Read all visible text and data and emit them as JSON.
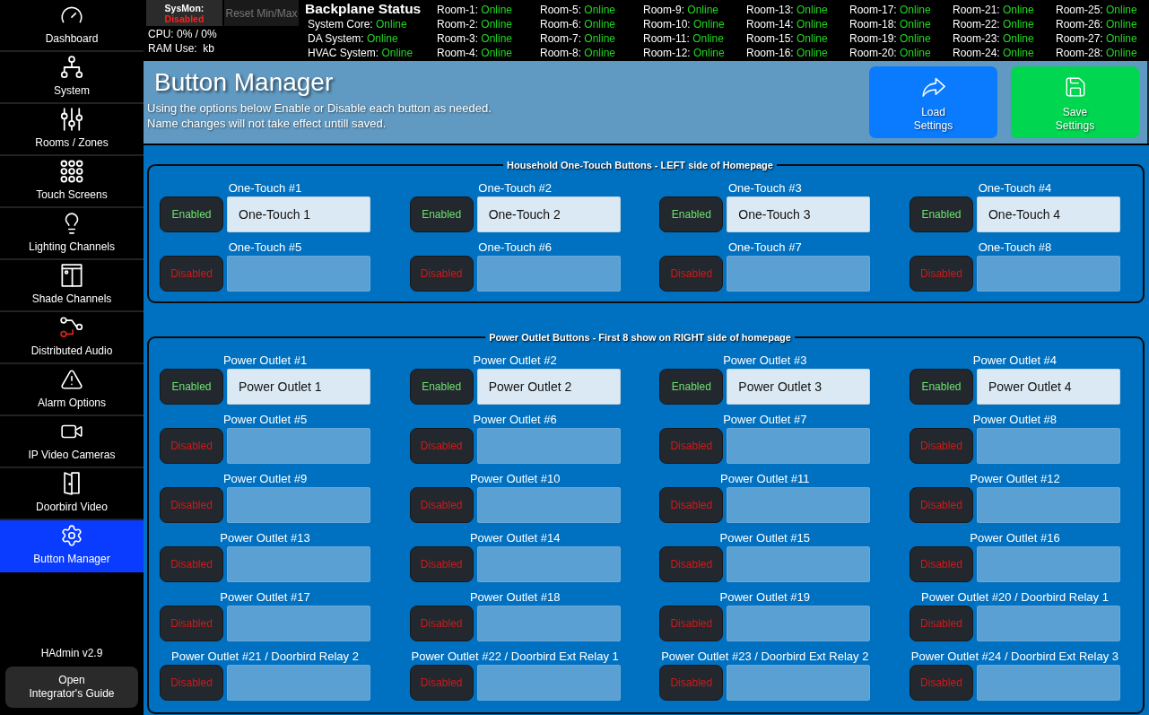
{
  "sidebar": {
    "items": [
      {
        "label": "Dashboard",
        "selected": false
      },
      {
        "label": "System",
        "selected": false
      },
      {
        "label": "Rooms / Zones",
        "selected": false
      },
      {
        "label": "Touch Screens",
        "selected": false
      },
      {
        "label": "Lighting Channels",
        "selected": false
      },
      {
        "label": "Shade Channels",
        "selected": false
      },
      {
        "label": "Distributed Audio",
        "selected": false
      },
      {
        "label": "Alarm Options",
        "selected": false
      },
      {
        "label": "IP Video Cameras",
        "selected": false
      },
      {
        "label": "Doorbird Video",
        "selected": false
      },
      {
        "label": "Button Manager",
        "selected": true
      }
    ],
    "version": "HAdmin v2.9",
    "guide_button": [
      "Open",
      "Integrator's Guide"
    ]
  },
  "status_bar": {
    "sysmon_button": {
      "label": "SysMon:",
      "status": "Disabled"
    },
    "reset_button": "Reset Min/Max",
    "cpu": "CPU: 0% / 0%",
    "ram": "RAM Use:  kb",
    "backplane": {
      "title": "Backplane Status",
      "systems": [
        {
          "name": "System Core:",
          "status": "Online"
        },
        {
          "name": "DA System:",
          "status": "Online"
        },
        {
          "name": "HVAC System:",
          "status": "Online"
        }
      ],
      "rooms": [
        {
          "name": "Room-1:",
          "status": "Online"
        },
        {
          "name": "Room-2:",
          "status": "Online"
        },
        {
          "name": "Room-3:",
          "status": "Online"
        },
        {
          "name": "Room-4:",
          "status": "Online"
        },
        {
          "name": "Room-5:",
          "status": "Online"
        },
        {
          "name": "Room-6:",
          "status": "Online"
        },
        {
          "name": "Room-7:",
          "status": "Online"
        },
        {
          "name": "Room-8:",
          "status": "Online"
        },
        {
          "name": "Room-9:",
          "status": "Online"
        },
        {
          "name": "Room-10:",
          "status": "Online"
        },
        {
          "name": "Room-11:",
          "status": "Online"
        },
        {
          "name": "Room-12:",
          "status": "Online"
        },
        {
          "name": "Room-13:",
          "status": "Online"
        },
        {
          "name": "Room-14:",
          "status": "Online"
        },
        {
          "name": "Room-15:",
          "status": "Online"
        },
        {
          "name": "Room-16:",
          "status": "Online"
        },
        {
          "name": "Room-17:",
          "status": "Online"
        },
        {
          "name": "Room-18:",
          "status": "Online"
        },
        {
          "name": "Room-19:",
          "status": "Online"
        },
        {
          "name": "Room-20:",
          "status": "Online"
        },
        {
          "name": "Room-21:",
          "status": "Online"
        },
        {
          "name": "Room-22:",
          "status": "Online"
        },
        {
          "name": "Room-23:",
          "status": "Online"
        },
        {
          "name": "Room-24:",
          "status": "Online"
        },
        {
          "name": "Room-25:",
          "status": "Online"
        },
        {
          "name": "Room-26:",
          "status": "Online"
        },
        {
          "name": "Room-27:",
          "status": "Online"
        },
        {
          "name": "Room-28:",
          "status": "Online"
        }
      ]
    }
  },
  "header": {
    "title": "Button Manager",
    "description": [
      "Using the options below Enable or Disable each button as needed.",
      "Name changes will not take effect untill saved."
    ],
    "buttons": [
      {
        "kind": "load",
        "label": [
          "Load",
          "Settings"
        ]
      },
      {
        "kind": "save",
        "label": [
          "Save",
          "Settings"
        ]
      }
    ]
  },
  "groups": [
    {
      "title": "Household One-Touch Buttons - LEFT side of Homepage",
      "buttons": [
        {
          "label": "One-Touch #1",
          "enabled": true,
          "toggle": "Enabled",
          "value": "One-Touch 1"
        },
        {
          "label": "One-Touch #2",
          "enabled": true,
          "toggle": "Enabled",
          "value": "One-Touch 2"
        },
        {
          "label": "One-Touch #3",
          "enabled": true,
          "toggle": "Enabled",
          "value": "One-Touch 3"
        },
        {
          "label": "One-Touch #4",
          "enabled": true,
          "toggle": "Enabled",
          "value": "One-Touch 4"
        },
        {
          "label": "One-Touch #5",
          "enabled": false,
          "toggle": "Disabled"
        },
        {
          "label": "One-Touch #6",
          "enabled": false,
          "toggle": "Disabled"
        },
        {
          "label": "One-Touch #7",
          "enabled": false,
          "toggle": "Disabled"
        },
        {
          "label": "One-Touch #8",
          "enabled": false,
          "toggle": "Disabled"
        }
      ]
    },
    {
      "title": "Power Outlet Buttons - First 8 show on RIGHT side of homepage",
      "buttons": [
        {
          "label": "Power Outlet #1",
          "enabled": true,
          "toggle": "Enabled",
          "value": "Power Outlet 1"
        },
        {
          "label": "Power Outlet #2",
          "enabled": true,
          "toggle": "Enabled",
          "value": "Power Outlet 2"
        },
        {
          "label": "Power Outlet #3",
          "enabled": true,
          "toggle": "Enabled",
          "value": "Power Outlet 3"
        },
        {
          "label": "Power Outlet #4",
          "enabled": true,
          "toggle": "Enabled",
          "value": "Power Outlet 4"
        },
        {
          "label": "Power Outlet #5",
          "enabled": false,
          "toggle": "Disabled"
        },
        {
          "label": "Power Outlet #6",
          "enabled": false,
          "toggle": "Disabled"
        },
        {
          "label": "Power Outlet #7",
          "enabled": false,
          "toggle": "Disabled"
        },
        {
          "label": "Power Outlet #8",
          "enabled": false,
          "toggle": "Disabled"
        },
        {
          "label": "Power Outlet #9",
          "enabled": false,
          "toggle": "Disabled"
        },
        {
          "label": "Power Outlet #10",
          "enabled": false,
          "toggle": "Disabled"
        },
        {
          "label": "Power Outlet #11",
          "enabled": false,
          "toggle": "Disabled"
        },
        {
          "label": "Power Outlet #12",
          "enabled": false,
          "toggle": "Disabled"
        },
        {
          "label": "Power Outlet #13",
          "enabled": false,
          "toggle": "Disabled"
        },
        {
          "label": "Power Outlet #14",
          "enabled": false,
          "toggle": "Disabled"
        },
        {
          "label": "Power Outlet #15",
          "enabled": false,
          "toggle": "Disabled"
        },
        {
          "label": "Power Outlet #16",
          "enabled": false,
          "toggle": "Disabled"
        },
        {
          "label": "Power Outlet #17",
          "enabled": false,
          "toggle": "Disabled"
        },
        {
          "label": "Power Outlet #18",
          "enabled": false,
          "toggle": "Disabled"
        },
        {
          "label": "Power Outlet #19",
          "enabled": false,
          "toggle": "Disabled"
        },
        {
          "label": "Power Outlet #20 / Doorbird Relay 1",
          "enabled": false,
          "toggle": "Disabled"
        },
        {
          "label": "Power Outlet #21 / Doorbird Relay 2",
          "enabled": false,
          "toggle": "Disabled"
        },
        {
          "label": "Power Outlet #22 / Doorbird Ext Relay 1",
          "enabled": false,
          "toggle": "Disabled"
        },
        {
          "label": "Power Outlet #23 / Doorbird Ext Relay 2",
          "enabled": false,
          "toggle": "Disabled"
        },
        {
          "label": "Power Outlet #24 / Doorbird Ext Relay 3",
          "enabled": false,
          "toggle": "Disabled"
        }
      ]
    }
  ]
}
